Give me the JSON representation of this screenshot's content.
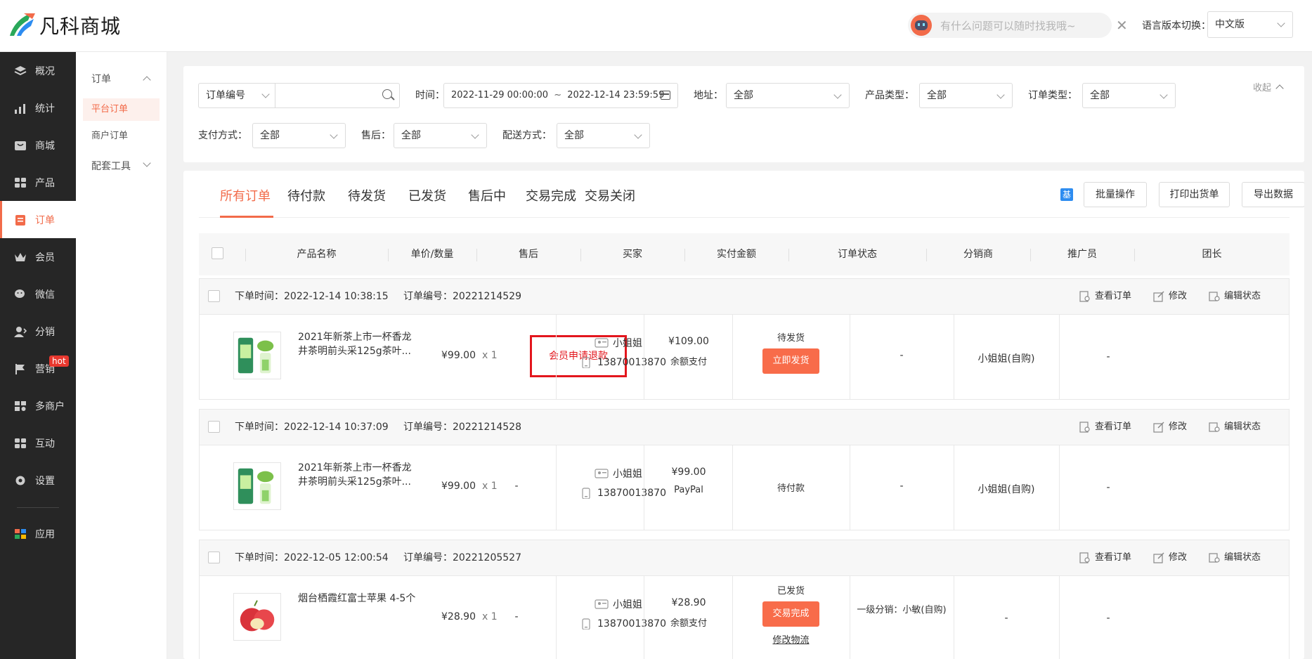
{
  "app": {
    "name": "凡科商城"
  },
  "header": {
    "assistant_placeholder": "有什么问题可以随时找我哦~",
    "lang_label": "语言版本切换：",
    "lang_value": "中文版"
  },
  "sidebar": {
    "items": [
      {
        "label": "概况",
        "icon": "layers-icon"
      },
      {
        "label": "统计",
        "icon": "chart-icon"
      },
      {
        "label": "商城",
        "icon": "mall-icon"
      },
      {
        "label": "产品",
        "icon": "grid-icon"
      },
      {
        "label": "订单",
        "icon": "order-icon"
      },
      {
        "label": "会员",
        "icon": "crown-icon"
      },
      {
        "label": "微信",
        "icon": "wechat-icon"
      },
      {
        "label": "分销",
        "icon": "user-share-icon"
      },
      {
        "label": "营销",
        "icon": "flag-icon",
        "badge": "hot"
      },
      {
        "label": "多商户",
        "icon": "store-icon"
      },
      {
        "label": "互动",
        "icon": "interact-icon"
      },
      {
        "label": "设置",
        "icon": "gear-icon"
      },
      {
        "label": "应用",
        "icon": "apps-icon"
      }
    ]
  },
  "subnav": {
    "group": "订单",
    "items": [
      "平台订单",
      "商户订单"
    ],
    "tools": "配套工具"
  },
  "filters": {
    "order_no_select": "订单编号",
    "time_label": "时间：",
    "time_start": "2022-11-29 00:00:00",
    "time_sep": "~",
    "time_end": "2022-12-14 23:59:59",
    "address_label": "地址：",
    "address_value": "全部",
    "product_type_label": "产品类型：",
    "product_type_value": "全部",
    "order_type_label": "订单类型：",
    "order_type_value": "全部",
    "collapse": "收起",
    "pay_label": "支付方式：",
    "pay_value": "全部",
    "after_label": "售后：",
    "after_value": "全部",
    "delivery_label": "配送方式：",
    "delivery_value": "全部"
  },
  "tabs": [
    "所有订单",
    "待付款",
    "待发货",
    "已发货",
    "售后中",
    "交易完成",
    "交易关闭"
  ],
  "toolbar": {
    "badge": "基",
    "batch": "批量操作",
    "print": "打印出货单",
    "export": "导出数据"
  },
  "table": {
    "columns": [
      "产品名称",
      "单价/数量",
      "售后",
      "买家",
      "实付金额",
      "订单状态",
      "分销商",
      "推广员",
      "团长"
    ]
  },
  "order_actions": {
    "view": "查看订单",
    "edit": "修改",
    "edit_status": "编辑状态"
  },
  "orders": [
    {
      "time_label": "下单时间：2022-12-14 10:38:15",
      "no_label": "订单编号：20221214529",
      "product": "2021年新茶上市一杯香龙井茶明前头采125g茶叶...",
      "price": "¥99.00",
      "qty": "x 1",
      "after_sale": "会员申请退款",
      "buyer": "小姐姐",
      "phone": "13870013870",
      "amount": "¥109.00",
      "pay_method": "余额支付",
      "status": "待发货",
      "status_button": "立即发货",
      "distributor": "-",
      "promoter": "小姐姐(自购)",
      "leader": "-"
    },
    {
      "time_label": "下单时间：2022-12-14 10:37:09",
      "no_label": "订单编号：20221214528",
      "product": "2021年新茶上市一杯香龙井茶明前头采125g茶叶...",
      "price": "¥99.00",
      "qty": "x 1",
      "after_sale": "-",
      "buyer": "小姐姐",
      "phone": "13870013870",
      "amount": "¥99.00",
      "pay_method": "PayPal",
      "status": "待付款",
      "distributor": "-",
      "promoter": "小姐姐(自购)",
      "leader": "-"
    },
    {
      "time_label": "下单时间：2022-12-05 12:00:54",
      "no_label": "订单编号：20221205527",
      "product": "烟台栖霞红富士苹果 4-5个",
      "price": "¥28.90",
      "qty": "x 1",
      "after_sale": "-",
      "buyer": "小姐姐",
      "phone": "13870013870",
      "amount": "¥28.90",
      "pay_method": "余额支付",
      "status": "已发货",
      "status_button": "交易完成",
      "status_link": "修改物流",
      "distributor": "一级分销：小敏(自购)",
      "promoter": "-",
      "leader": "-"
    }
  ]
}
